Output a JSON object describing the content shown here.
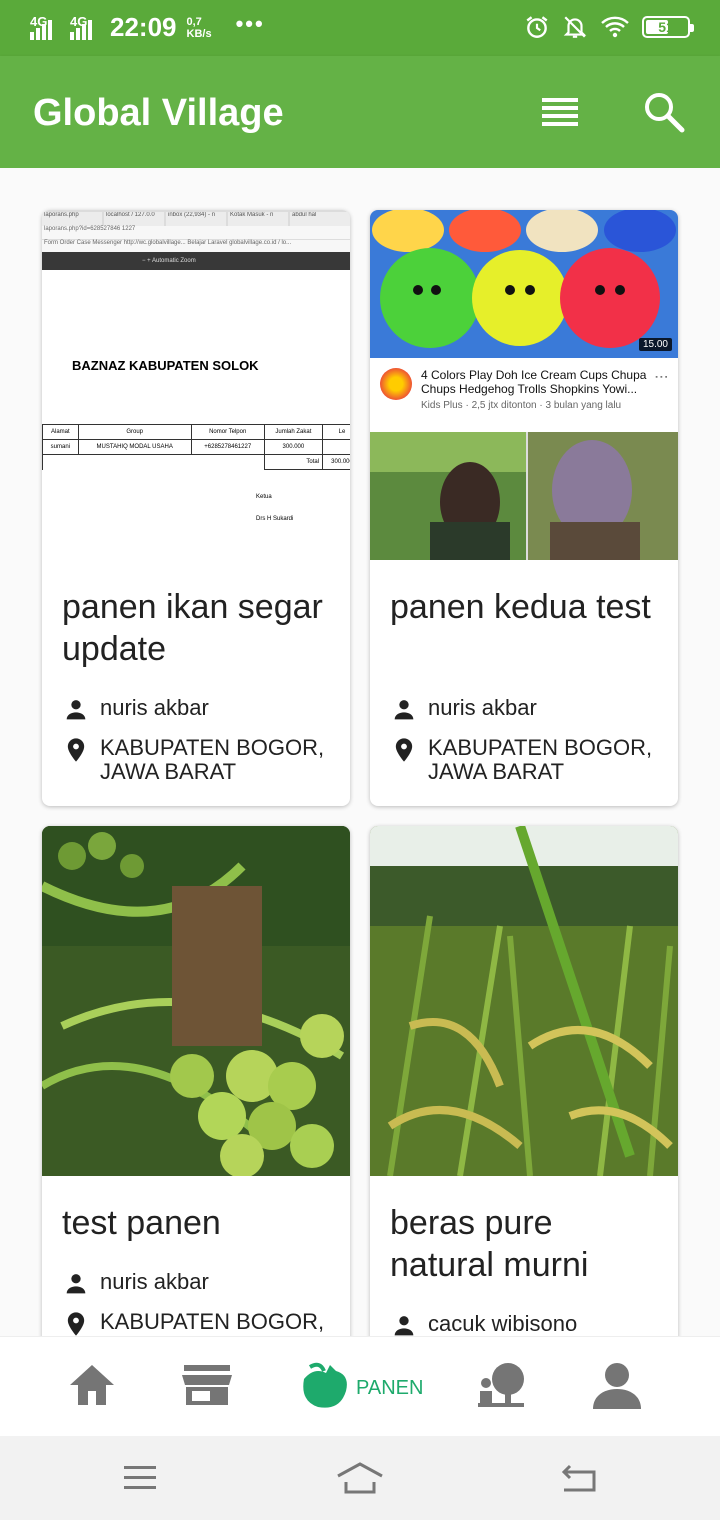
{
  "status_bar": {
    "network_1": "4G",
    "network_2": "4G",
    "time": "22:09",
    "speed_value": "0,7",
    "speed_unit": "KB/s",
    "more": "•••",
    "battery": "51"
  },
  "app_bar": {
    "title": "Global Village"
  },
  "cards": [
    {
      "title": "panen ikan segar update",
      "user": "nuris akbar",
      "location": "KABUPATEN BOGOR, JAWA BARAT",
      "thumb": {
        "tabs": [
          "laporans.php",
          "localhost / 127.0.0",
          "inbox (22,934) - n",
          "Kotak Masuk - n",
          "abdul hal"
        ],
        "url": "laporans.php?id=628527846 1227",
        "bookmarks": "Form Order   Case   Messenger   http://wc.globalvillage...   Belajar Laravel   globalvillage.co.id / lo...",
        "toolbar": "−   +   Automatic Zoom",
        "heading": "BAZNAZ KABUPATEN SOLOK",
        "table_header": [
          "Alamat",
          "Group",
          "Nomor Telpon",
          "Jumlah Zakat",
          "Le"
        ],
        "table_row": [
          "sumani",
          "MUSTAHIQ MODAL USAHA",
          "+6285278461227",
          "300.000",
          ""
        ],
        "total_label": "Total",
        "total_value": "300.000",
        "footer_1": "Ketua",
        "footer_2": "Drs H Sukardi"
      }
    },
    {
      "title": "panen kedua test",
      "user": "nuris akbar",
      "location": "KABUPATEN BOGOR, JAWA BARAT",
      "video": {
        "duration": "15.00",
        "title": "4 Colors Play Doh Ice Cream Cups Chupa Chups Hedgehog Trolls Shopkins Yowi...",
        "subtitle": "Kids Plus · 2,5 jtx ditonton · 3 bulan yang lalu"
      }
    },
    {
      "title": "test panen",
      "user": "nuris akbar",
      "location": "KABUPATEN BOGOR,"
    },
    {
      "title": "beras pure natural murni",
      "user": "cacuk wibisono"
    }
  ],
  "bottom_nav": {
    "active_label": "PANEN",
    "items": [
      "home-icon",
      "store-icon",
      "harvest-icon",
      "village-icon",
      "profile-icon"
    ]
  },
  "colors": {
    "status_bar": "#5aaa3a",
    "app_bar": "#64b246",
    "active": "#1eaa6c",
    "inactive": "#757575"
  }
}
